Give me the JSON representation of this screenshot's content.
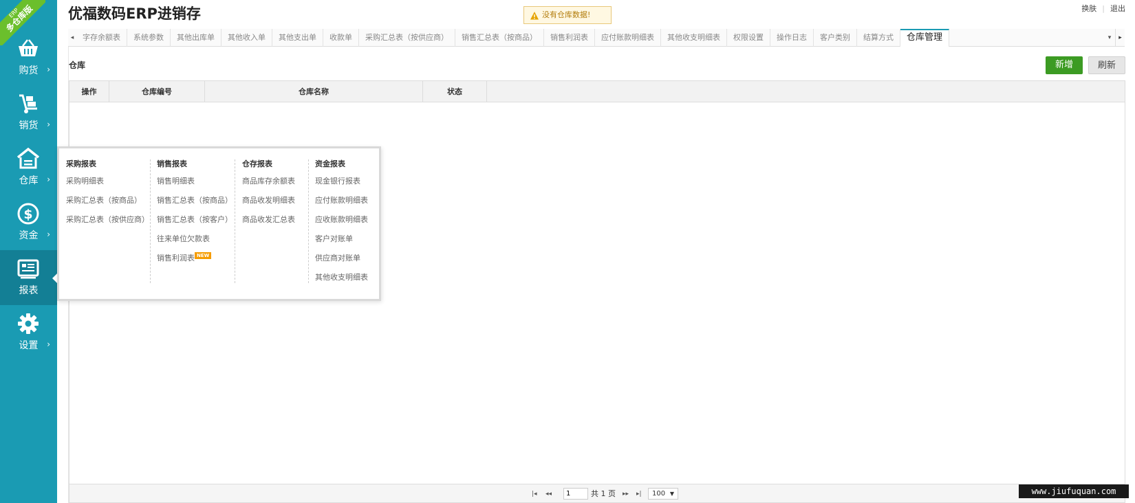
{
  "app": {
    "title": "优福数码ERP进销存",
    "alert": "没有仓库数据!",
    "top_links": [
      "换肤",
      "退出"
    ],
    "ribbon": {
      "line1": "ERP",
      "line2": "多仓库版"
    }
  },
  "colors": {
    "sidebar": "#1a9bb3",
    "sidebar_active": "#137f95",
    "primary_button": "#3c9b23",
    "ribbon": "#6bbf2c"
  },
  "sidebar": {
    "items": [
      {
        "label": "购货",
        "icon": "basket-icon",
        "arrow": "›"
      },
      {
        "label": "销货",
        "icon": "hand-truck-icon",
        "arrow": "›"
      },
      {
        "label": "仓库",
        "icon": "warehouse-icon",
        "arrow": "›"
      },
      {
        "label": "资金",
        "icon": "dollar-coin-icon",
        "arrow": "›"
      },
      {
        "label": "报表",
        "icon": "report-icon",
        "arrow": ""
      },
      {
        "label": "设置",
        "icon": "gear-icon",
        "arrow": "›"
      }
    ]
  },
  "tabs": {
    "items": [
      "字存余额表",
      "系统参数",
      "其他出库单",
      "其他收入单",
      "其他支出单",
      "收款单",
      "采购汇总表（按供应商）",
      "销售汇总表（按商品）",
      "销售利润表",
      "应付账款明细表",
      "其他收支明细表",
      "权限设置",
      "操作日志",
      "客户类别",
      "结算方式",
      "仓库管理"
    ],
    "active": "仓库管理"
  },
  "content": {
    "page_label": "仓库",
    "add_button": "新增",
    "refresh_button": "刷新",
    "columns": [
      "操作",
      "仓库编号",
      "仓库名称",
      "状态"
    ]
  },
  "pager": {
    "first": "|◂",
    "prev": "◂◂",
    "page_input": "1",
    "total": "共 1 页",
    "next": "▸▸",
    "last": "▸|",
    "page_size": "100"
  },
  "report_menu": {
    "columns": [
      {
        "title": "采购报表",
        "items": [
          "采购明细表",
          "采购汇总表（按商品）",
          "采购汇总表（按供应商）"
        ]
      },
      {
        "title": "销售报表",
        "items": [
          "销售明细表",
          "销售汇总表（按商品）",
          "销售汇总表（按客户）",
          "往来单位欠款表",
          "销售利润表"
        ],
        "badge": "NEW"
      },
      {
        "title": "仓存报表",
        "items": [
          "商品库存余额表",
          "商品收发明细表",
          "商品收发汇总表"
        ]
      },
      {
        "title": "资金报表",
        "items": [
          "现金银行报表",
          "应付账款明细表",
          "应收账款明细表",
          "客户对账单",
          "供应商对账单",
          "其他收支明细表"
        ]
      }
    ]
  },
  "watermark": "www.jiufuquan.com"
}
